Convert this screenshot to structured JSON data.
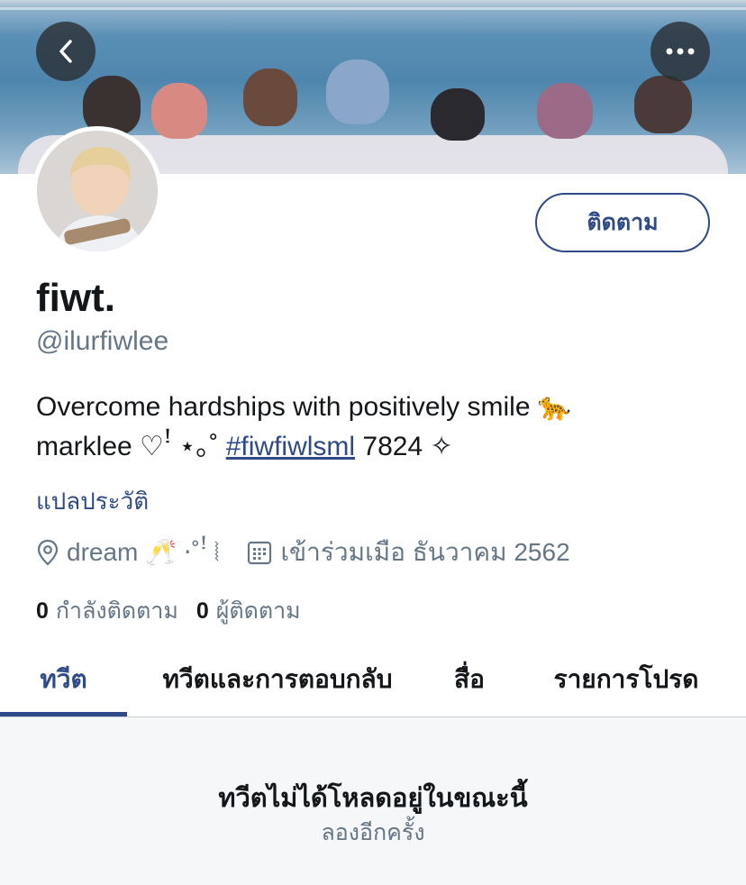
{
  "header": {
    "back_icon": "chevron-left-icon",
    "more_icon": "more-horizontal-icon"
  },
  "profile": {
    "display_name": "fiwt.",
    "handle": "@ilurfiwlee",
    "follow_label": "ติดตาม",
    "bio_line1_text": "Overcome hardships with positively smile",
    "bio_line1_emoji": "🐆",
    "bio_line2_prefix": "marklee ♡ꜝ ⋆｡˚",
    "bio_hashtag": "#fiwfiwlsml",
    "bio_line2_suffix": "7824 ✧",
    "translate_bio": "แปลประวัติ",
    "location": "dream 🥂 ⋅˚ꜝ ⦚",
    "joined": "เข้าร่วมเมือ ธันวาคม 2562",
    "following_count": "0",
    "following_label": "กำลังติดตาม",
    "followers_count": "0",
    "followers_label": "ผู้ติดตาม"
  },
  "tabs": [
    {
      "label": "ทวีต",
      "active": true
    },
    {
      "label": "ทวีตและการตอบกลับ",
      "active": false
    },
    {
      "label": "สื่อ",
      "active": false
    },
    {
      "label": "รายการโปรด",
      "active": false
    }
  ],
  "empty_state": {
    "title": "ทวีตไม่ได้โหลดอยู่ในขณะนี้",
    "retry": "ลองอีกครั้ง"
  },
  "colors": {
    "accent": "#2f4a86",
    "secondary_text": "#657786",
    "primary_text": "#14171a"
  }
}
